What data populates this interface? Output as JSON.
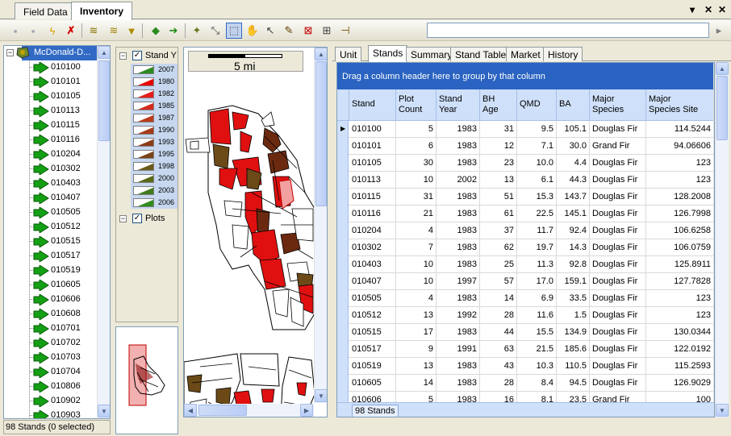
{
  "doc_tabs": {
    "field_data": "Field Data",
    "inventory": "Inventory"
  },
  "window_controls": {
    "dropdown": "▾",
    "close": "✕"
  },
  "tree": {
    "root_label": "McDonald-D...",
    "items": [
      "010100",
      "010101",
      "010105",
      "010113",
      "010115",
      "010116",
      "010204",
      "010302",
      "010403",
      "010407",
      "010505",
      "010512",
      "010515",
      "010517",
      "010519",
      "010605",
      "010606",
      "010608",
      "010701",
      "010702",
      "010703",
      "010704",
      "010806",
      "010902",
      "010903"
    ]
  },
  "status_left": "98 Stands (0 selected)",
  "legend": {
    "layer1": "Stand Y",
    "layer2": "Plots",
    "years": [
      {
        "label": "2007",
        "color": "#2a8a1e"
      },
      {
        "label": "1980",
        "color": "#e60000"
      },
      {
        "label": "1982",
        "color": "#e81c1c"
      },
      {
        "label": "1985",
        "color": "#d42a1e"
      },
      {
        "label": "1987",
        "color": "#bb3a1a"
      },
      {
        "label": "1990",
        "color": "#a83a1c"
      },
      {
        "label": "1993",
        "color": "#8c3c18"
      },
      {
        "label": "1995",
        "color": "#7a4418"
      },
      {
        "label": "1998",
        "color": "#6c5a1a"
      },
      {
        "label": "2000",
        "color": "#5a6a1a"
      },
      {
        "label": "2003",
        "color": "#3f7a1c"
      },
      {
        "label": "2006",
        "color": "#2f8c1e"
      }
    ]
  },
  "map": {
    "scale_label": "5 mi"
  },
  "right_tabs": [
    "Unit",
    "Stands",
    "Summary",
    "Stand Table",
    "Market",
    "History"
  ],
  "grid": {
    "group_hint": "Drag a column header here to group by that column",
    "columns": [
      "Stand",
      "Plot\nCount",
      "Stand\nYear",
      "BH\nAge",
      "QMD",
      "BA",
      "Major\nSpecies",
      "Major\nSpecies Site"
    ],
    "rows": [
      [
        "010100",
        "5",
        "1983",
        "31",
        "9.5",
        "105.1",
        "Douglas Fir",
        "114.5244"
      ],
      [
        "010101",
        "6",
        "1983",
        "12",
        "7.1",
        "30.0",
        "Grand Fir",
        "94.06606"
      ],
      [
        "010105",
        "30",
        "1983",
        "23",
        "10.0",
        "4.4",
        "Douglas Fir",
        "123"
      ],
      [
        "010113",
        "10",
        "2002",
        "13",
        "6.1",
        "44.3",
        "Douglas Fir",
        "123"
      ],
      [
        "010115",
        "31",
        "1983",
        "51",
        "15.3",
        "143.7",
        "Douglas Fir",
        "128.2008"
      ],
      [
        "010116",
        "21",
        "1983",
        "61",
        "22.5",
        "145.1",
        "Douglas Fir",
        "126.7998"
      ],
      [
        "010204",
        "4",
        "1983",
        "37",
        "11.7",
        "92.4",
        "Douglas Fir",
        "106.6258"
      ],
      [
        "010302",
        "7",
        "1983",
        "62",
        "19.7",
        "14.3",
        "Douglas Fir",
        "106.0759"
      ],
      [
        "010403",
        "10",
        "1983",
        "25",
        "11.3",
        "92.8",
        "Douglas Fir",
        "125.8911"
      ],
      [
        "010407",
        "10",
        "1997",
        "57",
        "17.0",
        "159.1",
        "Douglas Fir",
        "127.7828"
      ],
      [
        "010505",
        "4",
        "1983",
        "14",
        "6.9",
        "33.5",
        "Douglas Fir",
        "123"
      ],
      [
        "010512",
        "13",
        "1992",
        "28",
        "11.6",
        "1.5",
        "Douglas Fir",
        "123"
      ],
      [
        "010515",
        "17",
        "1983",
        "44",
        "15.5",
        "134.9",
        "Douglas Fir",
        "130.0344"
      ],
      [
        "010517",
        "9",
        "1991",
        "63",
        "21.5",
        "185.6",
        "Douglas Fir",
        "122.0192"
      ],
      [
        "010519",
        "13",
        "1983",
        "43",
        "10.3",
        "110.5",
        "Douglas Fir",
        "115.2593"
      ],
      [
        "010605",
        "14",
        "1983",
        "28",
        "8.4",
        "94.5",
        "Douglas Fir",
        "126.9029"
      ],
      [
        "010606",
        "5",
        "1983",
        "16",
        "8.1",
        "23.5",
        "Grand Fir",
        "100"
      ]
    ],
    "footer_count": "98 Stands"
  }
}
